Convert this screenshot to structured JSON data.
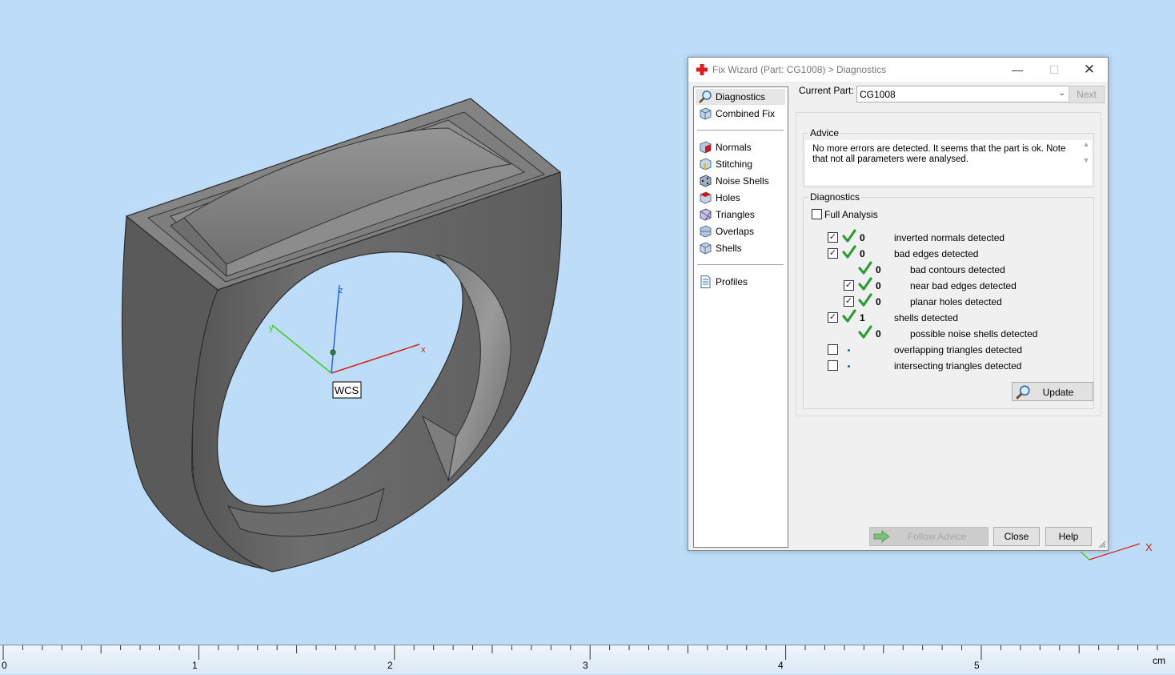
{
  "viewport": {
    "wcs_label": "WCS",
    "axis_x": "x",
    "axis_y": "y",
    "axis_z": "z",
    "corner_axis_x": "X"
  },
  "ruler": {
    "labels": [
      "0",
      "1",
      "2",
      "3",
      "4",
      "5"
    ],
    "unit": "cm"
  },
  "dialog": {
    "title": "Fix Wizard (Part: CG1008) > Diagnostics",
    "sidebar": {
      "top": [
        {
          "label": "Diagnostics",
          "icon": "magnifier-icon",
          "selected": true
        },
        {
          "label": "Combined Fix",
          "icon": "cube-icon"
        }
      ],
      "tools": [
        {
          "label": "Normals",
          "icon": "normals-icon"
        },
        {
          "label": "Stitching",
          "icon": "stitching-icon"
        },
        {
          "label": "Noise Shells",
          "icon": "noise-shells-icon"
        },
        {
          "label": "Holes",
          "icon": "holes-icon"
        },
        {
          "label": "Triangles",
          "icon": "triangles-icon"
        },
        {
          "label": "Overlaps",
          "icon": "overlaps-icon"
        },
        {
          "label": "Shells",
          "icon": "shells-icon"
        }
      ],
      "bottom": [
        {
          "label": "Profiles",
          "icon": "document-icon"
        }
      ]
    },
    "current_part_label": "Current Part:",
    "current_part_value": "CG1008",
    "next_label": "Next",
    "advice": {
      "label": "Advice",
      "text": "No more errors are detected. It seems that the part is ok. Note that not all parameters were analysed."
    },
    "diagnostics": {
      "label": "Diagnostics",
      "full_analysis_label": "Full Analysis",
      "full_analysis_checked": false,
      "rows": [
        {
          "indent": 0,
          "checked": true,
          "status": "ok",
          "count": "0",
          "label": "inverted normals detected"
        },
        {
          "indent": 0,
          "checked": true,
          "status": "ok",
          "count": "0",
          "label": "bad edges detected"
        },
        {
          "indent": 1,
          "checked": null,
          "status": "ok",
          "count": "0",
          "label": "bad contours detected"
        },
        {
          "indent": 1,
          "checked": true,
          "status": "ok",
          "count": "0",
          "label": "near bad edges detected"
        },
        {
          "indent": 1,
          "checked": true,
          "status": "ok",
          "count": "0",
          "label": "planar holes detected"
        },
        {
          "indent": 0,
          "checked": true,
          "status": "ok",
          "count": "1",
          "label": "shells detected"
        },
        {
          "indent": 1,
          "checked": null,
          "status": "ok",
          "count": "0",
          "label": "possible noise shells detected"
        },
        {
          "indent": 0,
          "checked": false,
          "status": "unknown",
          "count": "",
          "label": "overlapping triangles detected"
        },
        {
          "indent": 0,
          "checked": false,
          "status": "unknown",
          "count": "",
          "label": "intersecting triangles detected"
        }
      ],
      "update_label": "Update"
    },
    "buttons": {
      "follow_advice": "Follow Advice",
      "close": "Close",
      "help": "Help"
    },
    "colors": {
      "accent_green": "#2e9b3a",
      "viewport_bg": "#bddcf7",
      "axis_x": "#d42020",
      "axis_y": "#3ccc1e",
      "axis_z": "#2a63e0"
    }
  }
}
